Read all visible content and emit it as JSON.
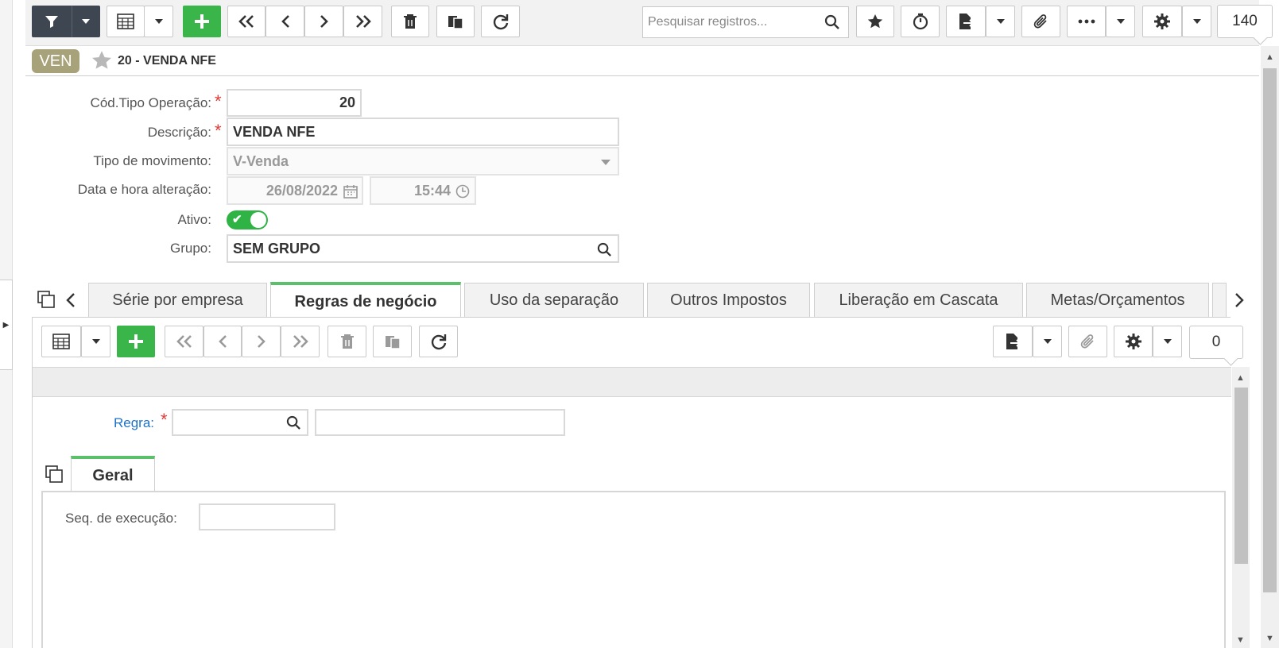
{
  "toolbar": {
    "search_placeholder": "Pesquisar registros...",
    "record_count": "140",
    "icons": [
      "filter-icon",
      "caret-down-icon",
      "grid-icon",
      "plus-icon",
      "first-icon",
      "prev-icon",
      "next-icon",
      "last-icon",
      "trash-icon",
      "copy-icon",
      "refresh-icon",
      "search-icon",
      "star-icon",
      "timer-icon",
      "export-icon",
      "paperclip-icon",
      "more-icon",
      "gear-icon"
    ]
  },
  "header": {
    "badge": "VEN",
    "title": "20 - VENDA NFE"
  },
  "form": {
    "cod_label": "Cód.Tipo Operação:",
    "cod_value": "20",
    "desc_label": "Descrição:",
    "desc_value": "VENDA NFE",
    "tipo_label": "Tipo de movimento:",
    "tipo_value": "V-Venda",
    "data_label": "Data e hora alteração:",
    "date_value": "26/08/2022",
    "time_value": "15:44",
    "ativo_label": "Ativo:",
    "ativo_checked": true,
    "grupo_label": "Grupo:",
    "grupo_value": "SEM GRUPO",
    "required_mark": "*"
  },
  "tabs": [
    {
      "label": "Série por empresa"
    },
    {
      "label": "Regras de negócio",
      "active": true
    },
    {
      "label": "Uso da separação"
    },
    {
      "label": "Outros Impostos"
    },
    {
      "label": "Liberação em Cascata"
    },
    {
      "label": "Metas/Orçamentos"
    }
  ],
  "detail": {
    "record_count": "0",
    "regra_label": "Regra:",
    "regra_required": "*",
    "subtab_label": "Geral",
    "seq_label": "Seq. de execução:"
  },
  "colors": {
    "accent_green": "#3ab54a",
    "toolbar_dark": "#3e4652",
    "badge": "#a7a27a",
    "required": "#e53935",
    "link": "#1e72c7"
  }
}
